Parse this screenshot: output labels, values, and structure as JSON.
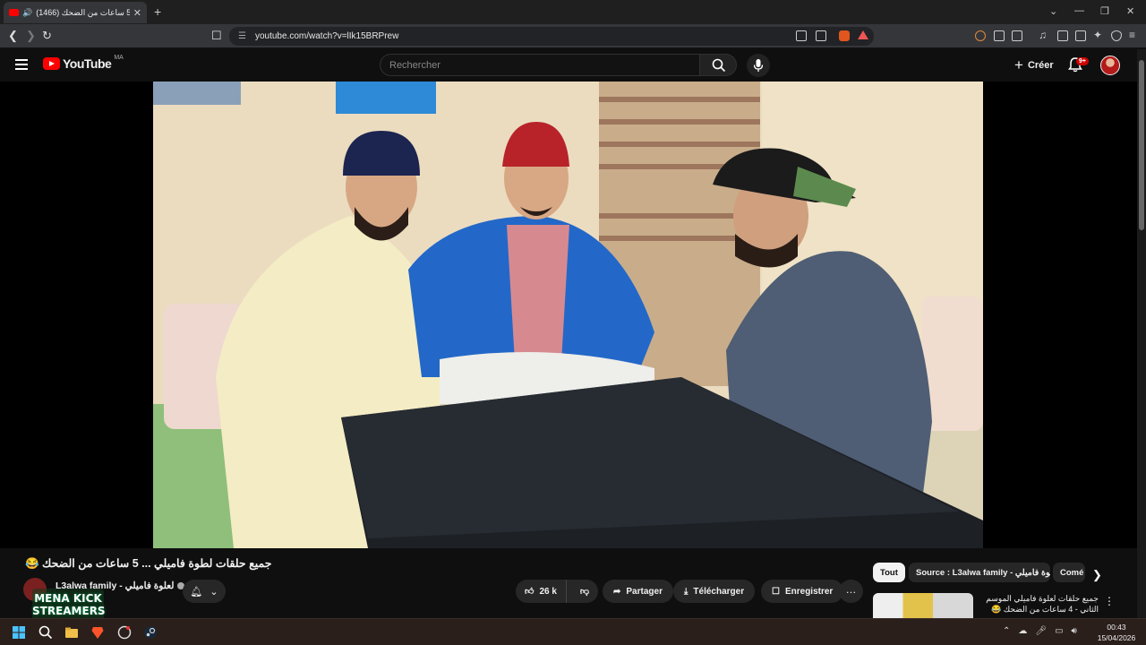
{
  "browser": {
    "tab_title": "(1466) جميع حلقات لطوة فاميلي ... 5 ساعات من الضحك 😂",
    "new_tab_symbol": "+",
    "url": "youtube.com/watch?v=lIk15BRPrew",
    "window_controls": [
      "⌄",
      "—",
      "❐",
      "✕"
    ]
  },
  "youtube": {
    "logo_text": "YouTube",
    "country_code": "MA",
    "search_placeholder": "Rechercher",
    "create_label": "Créer",
    "notification_badge": "9+"
  },
  "video": {
    "title": "جميع حلقات لطوة فاميلي ... 5 ساعات من الضحك 😂",
    "channel_name": "L3alwa family - لعلوة فاميلي",
    "like_count": "26 k",
    "actions": {
      "share": "Partager",
      "download": "Télécharger",
      "save": "Enregistrer"
    }
  },
  "sidebar": {
    "chips": [
      "Tout",
      "Source : L3alwa family - لعلوة فاميلي",
      "Comé"
    ],
    "recommendation": {
      "title": "جميع حلقات لعلوة فاميلي الموسم الثاني - 4 ساعات من الضحك 😂"
    }
  },
  "overlay": {
    "line1": "MENA KICK",
    "line2": "STREAMERS"
  },
  "taskbar": {
    "time": "00:43",
    "date": "15/04/2026"
  }
}
